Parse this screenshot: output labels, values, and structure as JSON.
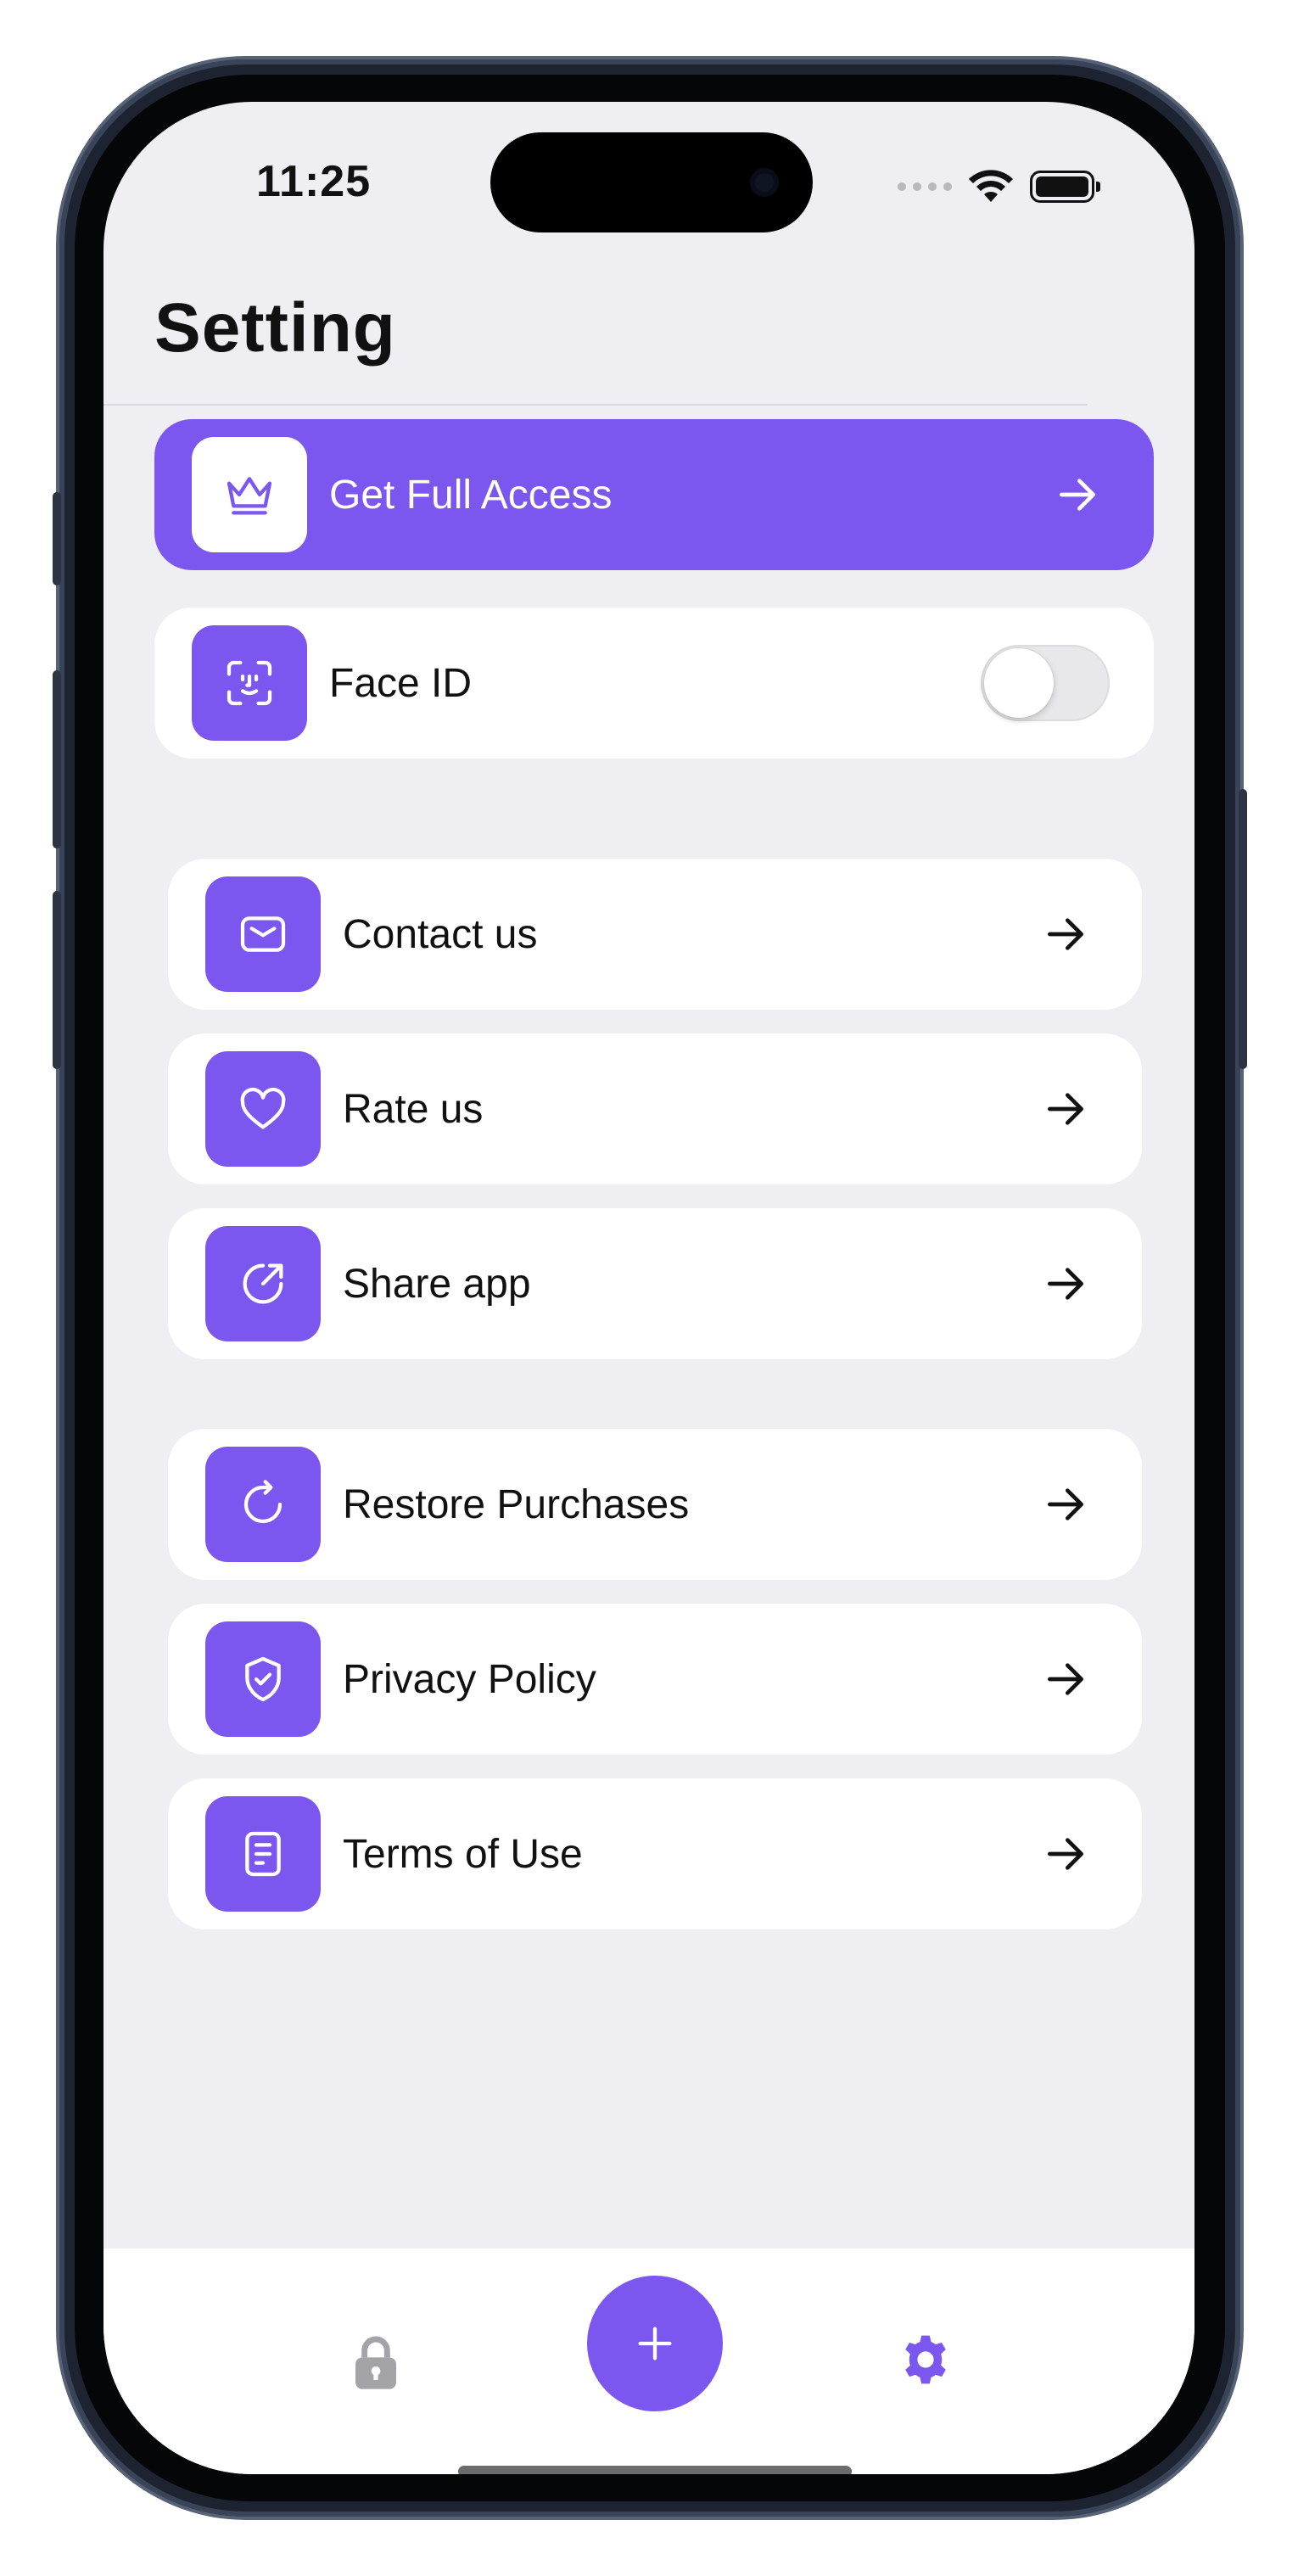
{
  "status_bar": {
    "time": "11:25"
  },
  "page": {
    "title": "Setting"
  },
  "premium": {
    "label": "Get Full Access",
    "icon": "crown-icon"
  },
  "face_id": {
    "label": "Face ID",
    "enabled": false,
    "icon": "face-id-icon"
  },
  "menu_group_1": [
    {
      "label": "Contact us",
      "icon": "mail-icon"
    },
    {
      "label": "Rate us",
      "icon": "heart-icon"
    },
    {
      "label": "Share app",
      "icon": "share-icon"
    }
  ],
  "menu_group_2": [
    {
      "label": "Restore Purchases",
      "icon": "restore-icon"
    },
    {
      "label": "Privacy Policy",
      "icon": "shield-check-icon"
    },
    {
      "label": "Terms of Use",
      "icon": "document-icon"
    }
  ],
  "tab_bar": {
    "items": [
      {
        "icon": "lock-icon",
        "active": false
      },
      {
        "icon": "plus-icon",
        "active": false
      },
      {
        "icon": "gear-icon",
        "active": true
      }
    ]
  },
  "colors": {
    "accent": "#7b57ef",
    "background": "#efeef3",
    "card": "#ffffff",
    "inactive_icon": "#a4a4a8"
  }
}
